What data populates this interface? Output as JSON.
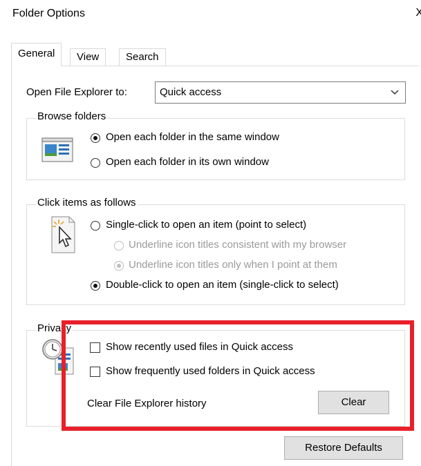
{
  "window": {
    "title": "Folder Options",
    "close_glyph": "X"
  },
  "tabs": [
    {
      "label": "General",
      "active": true
    },
    {
      "label": "View",
      "active": false
    },
    {
      "label": "Search",
      "active": false
    }
  ],
  "open_explorer": {
    "label": "Open File Explorer to:",
    "value": "Quick access"
  },
  "browse_folders": {
    "legend": "Browse folders",
    "icon": "browse-folders-icon",
    "options": [
      {
        "label": "Open each folder in the same window",
        "checked": true
      },
      {
        "label": "Open each folder in its own window",
        "checked": false
      }
    ]
  },
  "click_items": {
    "legend": "Click items as follows",
    "icon": "pointer-cursor-icon",
    "single_click": "Single-click to open an item (point to select)",
    "underline_browser": "Underline icon titles consistent with my browser",
    "underline_point": "Underline icon titles only when I point at them",
    "double_click": "Double-click to open an item (single-click to select)"
  },
  "privacy": {
    "legend": "Privacy",
    "icon": "privacy-clock-icon",
    "recent_files": "Show recently used files in Quick access",
    "frequent_folders": "Show frequently used folders in Quick access",
    "clear_history_label": "Clear File Explorer history",
    "clear_button": "Clear"
  },
  "restore_defaults": "Restore Defaults",
  "colors": {
    "highlight_box": "#e8202a",
    "border": "#dcdcdc",
    "button_face": "#e1e1e1"
  }
}
